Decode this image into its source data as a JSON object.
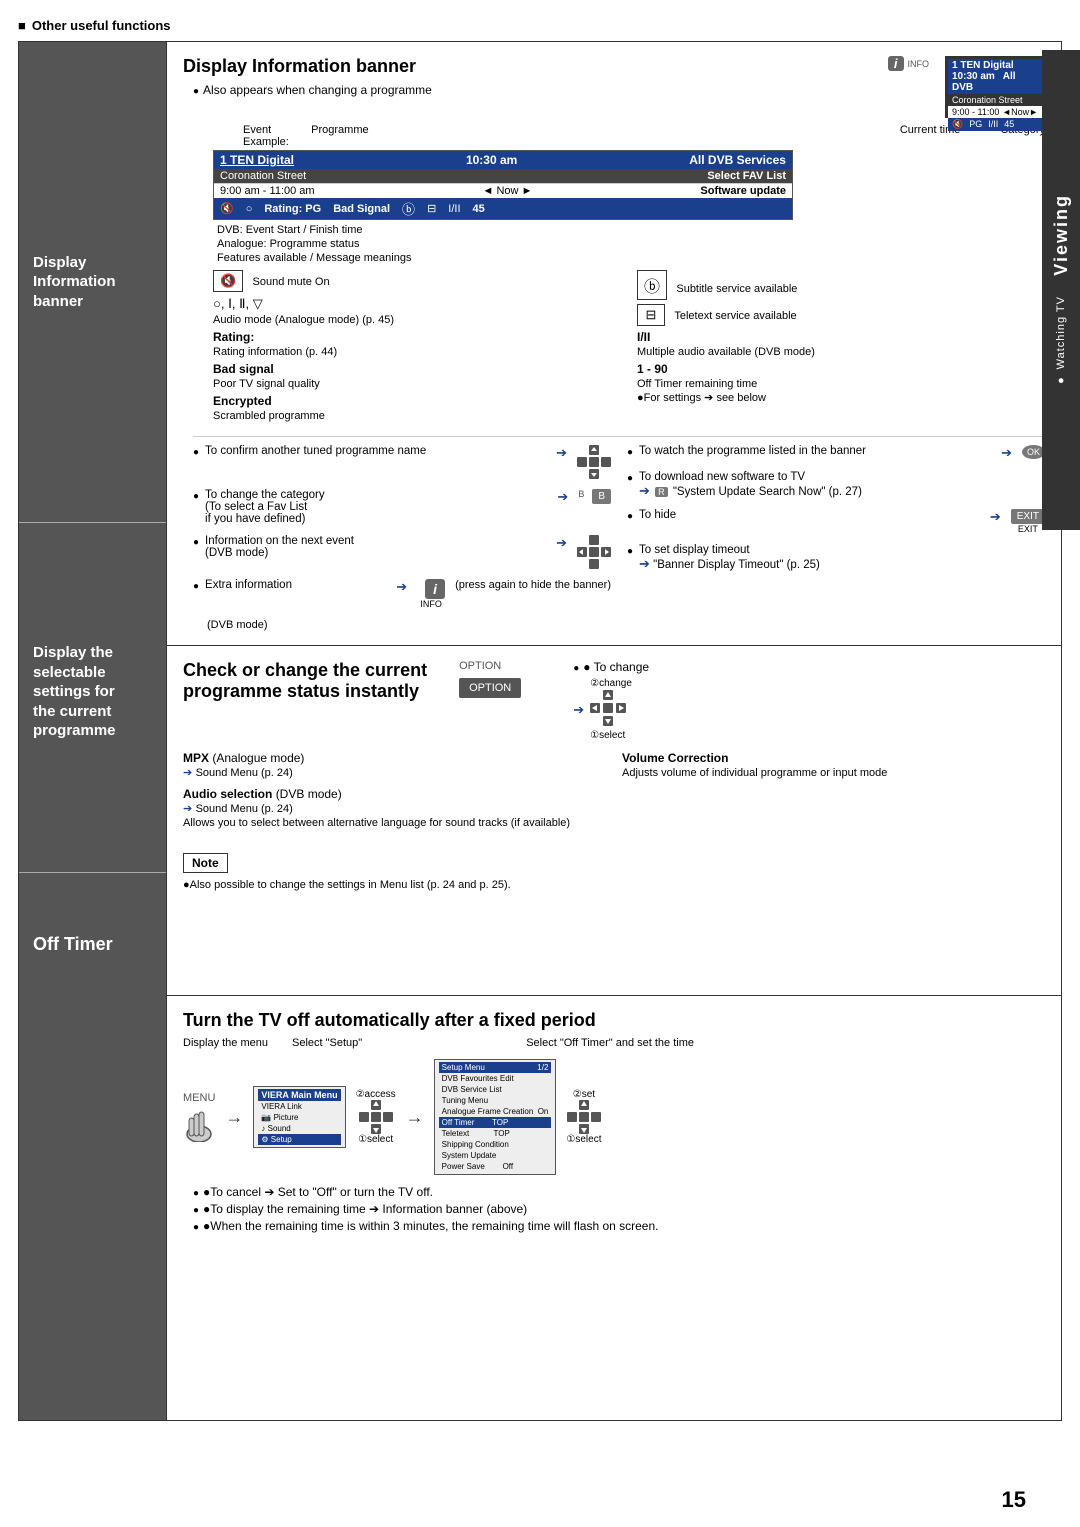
{
  "page": {
    "header": "Other useful functions",
    "page_number": "15",
    "right_sidebar": {
      "viewing": "Viewing",
      "watching": "● Watching TV"
    }
  },
  "section1": {
    "title": "Display Information banner",
    "also_appears": "Also appears when changing a programme",
    "labels": {
      "event": "Event",
      "programme": "Programme",
      "example": "Example:",
      "current_time": "Current time",
      "category": "Category"
    },
    "banner": {
      "row1_ch": "1 TEN Digital",
      "row1_time": "10:30 am",
      "row1_fav": "All DVB Services",
      "row2_programme": "Coronation Street",
      "row2_fav": "Select FAV List",
      "row3_time": "9:00 am - 11:00 am",
      "row3_now": "◄ Now ►",
      "row3_update": "Software update",
      "row4_items": "🔇  ○  Rating: PG   Bad Signal   ⓑ  ⊟  I/II  45"
    },
    "dvb_note": "DVB: Event Start / Finish time",
    "analogue_note": "Analogue: Programme status",
    "features_note": "Features available / Message meanings",
    "symbols": [
      {
        "symbol": "🔇",
        "label": "Sound mute On"
      },
      {
        "symbol": "ⓑ",
        "label": "Subtitle service available"
      },
      {
        "symbol": "○, I, II, ▽",
        "label": "Audio mode (Analogue mode) (p. 45)"
      },
      {
        "symbol": "⊟",
        "label": "Teletext service available"
      },
      {
        "symbol": "Rating:",
        "label": "Rating information (p. 44)"
      },
      {
        "symbol": "I/II",
        "label": "Multiple audio available (DVB mode)"
      },
      {
        "symbol": "Bad signal",
        "label": "Poor TV signal quality"
      },
      {
        "symbol": "1 - 90",
        "label": "Off Timer remaining time"
      },
      {
        "symbol": "Encrypted",
        "label": "Scrambled programme"
      },
      {
        "symbol": "● For settings",
        "label": "see below"
      }
    ],
    "keys": {
      "left": [
        {
          "text": "To confirm another tuned programme name",
          "icon": "dpad-updown"
        },
        {
          "text": "To change the category (To select a Fav List if you have defined)",
          "icon": "b-button"
        },
        {
          "text": "Information on the next event (DVB mode)",
          "icon": "dpad-leftright"
        },
        {
          "text": "Extra information (press again to hide the banner) (DVB mode)",
          "icon": "info-button"
        }
      ],
      "right": [
        {
          "text": "To watch the programme listed in the banner",
          "icon": "ok-button"
        },
        {
          "text": "To download new software to TV → \"System Update Search Now\" (p. 27)",
          "icon": "r-button"
        },
        {
          "text": "To hide",
          "icon": "exit-button"
        },
        {
          "text": "To set display timeout → \"Banner Display Timeout\" (p. 25)",
          "icon": ""
        }
      ]
    }
  },
  "section2": {
    "title": "Check or change the current programme status instantly",
    "option_label": "OPTION",
    "to_change": "● To change",
    "change_label": "②change",
    "select_label": "①select",
    "settings": [
      {
        "bold": "MPX",
        "detail": "(Analogue mode)",
        "sub": "➔ Sound Menu (p. 24)"
      },
      {
        "bold": "Audio selection",
        "detail": "(DVB mode)",
        "sub": "➔ Sound Menu (p. 24)",
        "extra": "Allows you to select between alternative language for sound tracks (if available)"
      }
    ],
    "volume_correction": {
      "bold": "Volume Correction",
      "detail": "Adjusts volume of individual programme or input mode"
    },
    "note": {
      "label": "Note",
      "text": "●Also possible to change the settings in Menu list (p. 24 and p. 25)."
    }
  },
  "section3": {
    "title": "Turn the TV off automatically after a fixed period",
    "step1_label": "Display the menu",
    "step2_label": "Select \"Setup\"",
    "step3_label": "Select \"Off Timer\" and set the time",
    "menu_button_label": "MENU",
    "viera_menu_items": [
      "VIERA Link",
      "Picture",
      "Sound",
      "Setup"
    ],
    "setup_menu_items": [
      "DVB Favourites Edit",
      "DVB Service List",
      "Tuning Menu",
      "Analogue Frame Creation: On",
      "Off Timer",
      "Teletext",
      "Shipping Condition",
      "System Update",
      "Power Save"
    ],
    "setup_menu_values": [
      "",
      "",
      "",
      "",
      "TOP",
      "",
      "",
      "",
      "Off"
    ],
    "access_label": "②access",
    "select1_label": "①select",
    "set_label": "②set",
    "select2_label": "①select",
    "cancel_note": "●To cancel ➔ Set to \"Off\" or turn the TV off.",
    "remaining_note": "●To display the remaining time ➔ Information banner (above)",
    "flash_note": "●When the remaining time is within 3 minutes, the remaining time will flash on screen."
  }
}
